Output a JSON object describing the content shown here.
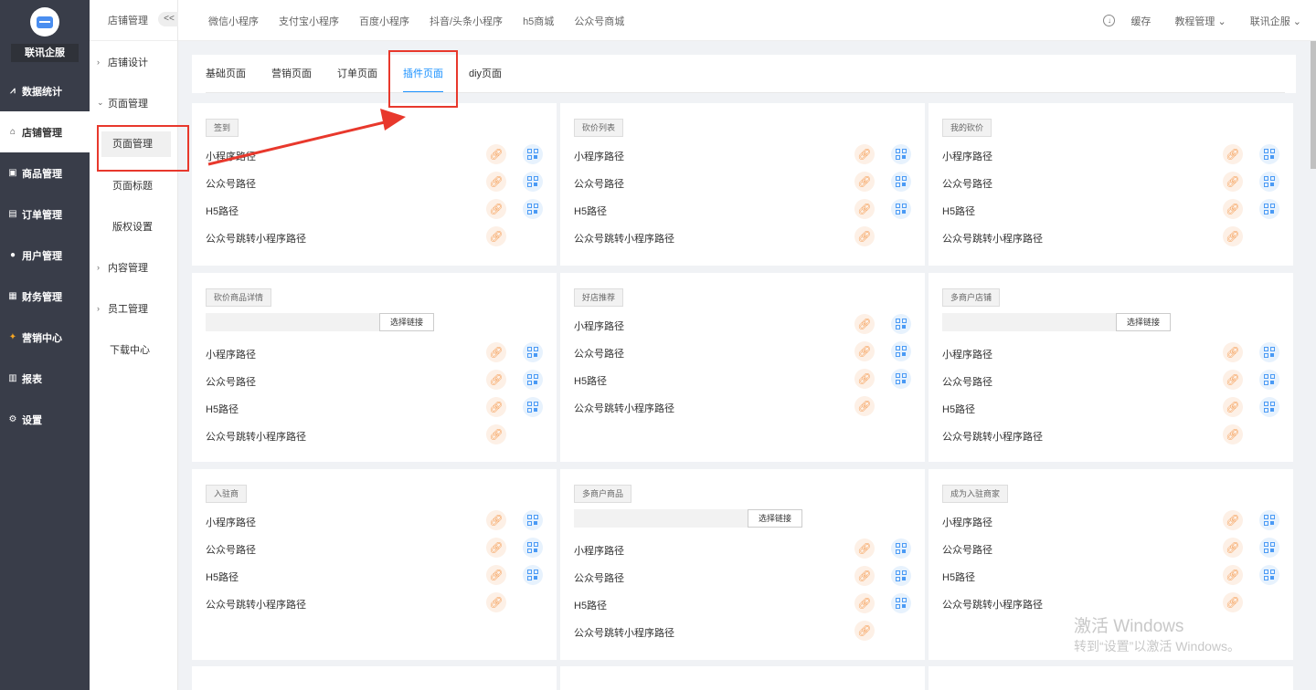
{
  "sidebar": {
    "brand": "联讯企服",
    "items": [
      {
        "label": "数据统计",
        "icon": "chart-icon"
      },
      {
        "label": "店铺管理",
        "icon": "shop-icon"
      },
      {
        "label": "商品管理",
        "icon": "goods-icon"
      },
      {
        "label": "订单管理",
        "icon": "order-icon"
      },
      {
        "label": "用户管理",
        "icon": "user-icon"
      },
      {
        "label": "财务管理",
        "icon": "finance-icon"
      },
      {
        "label": "营销中心",
        "icon": "marketing-icon"
      },
      {
        "label": "报表",
        "icon": "report-icon"
      },
      {
        "label": "设置",
        "icon": "settings-icon"
      }
    ]
  },
  "subnav": {
    "header": "店铺管理",
    "collapse": "<<",
    "items": [
      {
        "label": "店铺设计"
      },
      {
        "label": "页面管理"
      },
      {
        "label": "页面管理"
      },
      {
        "label": "页面标题"
      },
      {
        "label": "版权设置"
      },
      {
        "label": "内容管理"
      },
      {
        "label": "员工管理"
      },
      {
        "label": "下载中心"
      }
    ]
  },
  "topbar": {
    "tabs": [
      "微信小程序",
      "支付宝小程序",
      "百度小程序",
      "抖音/头条小程序",
      "h5商城",
      "公众号商城"
    ],
    "cache": "缓存",
    "tutorial": "教程管理 ⌄",
    "company": "联讯企服 ⌄"
  },
  "content_tabs": [
    "基础页面",
    "营销页面",
    "订单页面",
    "插件页面",
    "diy页面"
  ],
  "active_tab_index": 3,
  "row_labels": {
    "mini": "小程序路径",
    "mp": "公众号路径",
    "h5": "H5路径",
    "jump": "公众号跳转小程序路径"
  },
  "select_link_label": "选择链接",
  "cards": [
    {
      "title": "签到"
    },
    {
      "title": "砍价列表"
    },
    {
      "title": "我的砍价"
    },
    {
      "title": "砍价商品详情"
    },
    {
      "title": "好店推荐"
    },
    {
      "title": "多商户店铺"
    },
    {
      "title": "入驻商"
    },
    {
      "title": "多商户商品"
    },
    {
      "title": "成为入驻商家"
    }
  ],
  "watermark": {
    "line1": "激活 Windows",
    "line2": "转到“设置”以激活 Windows。"
  },
  "colors": {
    "sidebar_bg": "#393d49",
    "accent": "#1890ff",
    "annotation": "#e8382c"
  }
}
